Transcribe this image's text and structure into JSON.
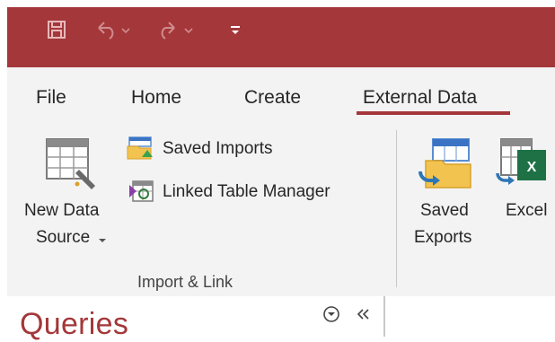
{
  "quick_access_toolbar": {
    "items": [
      {
        "icon": "save-icon"
      },
      {
        "icon": "undo-icon"
      },
      {
        "icon": "redo-icon"
      },
      {
        "icon": "customize-qat-icon"
      }
    ]
  },
  "tabs": [
    {
      "label": "File",
      "active": false
    },
    {
      "label": "Home",
      "active": false
    },
    {
      "label": "Create",
      "active": false
    },
    {
      "label": "External Data",
      "active": true
    }
  ],
  "ribbon": {
    "import_link_group": {
      "new_data_source_line1": "New Data",
      "new_data_source_line2": "Source",
      "saved_imports": "Saved Imports",
      "linked_table_manager": "Linked Table Manager",
      "group_label": "Import & Link"
    },
    "export_group": {
      "saved_exports_line1": "Saved",
      "saved_exports_line2": "Exports",
      "excel": "Excel"
    }
  },
  "nav_pane": {
    "heading": "Queries"
  },
  "colors": {
    "accent": "#a4373a",
    "ribbon_bg": "#f3f3f3",
    "excel_green": "#1e7145"
  }
}
